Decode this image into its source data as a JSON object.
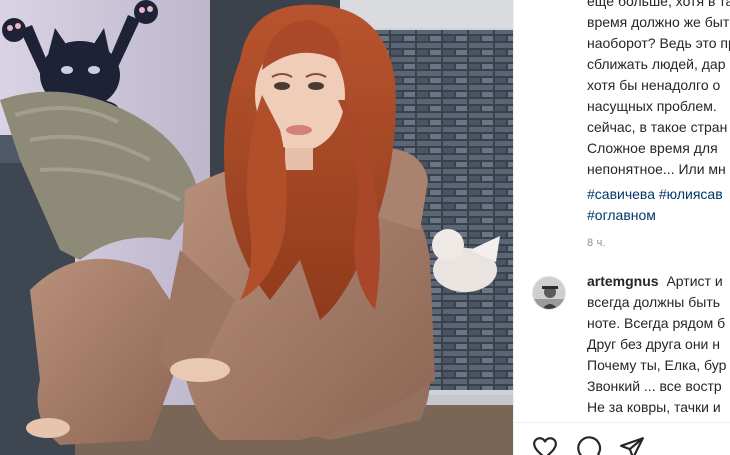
{
  "post": {
    "caption_lines": [
      "ещё больше, хотя в такое",
      "время должно же быть",
      "наоборот? Ведь это пр",
      "сближать людей, дар",
      "хотя бы ненадолго о",
      "насущных проблем.",
      "сейчас, в такое стран",
      "Сложное время для",
      "непонятное... Или мн"
    ],
    "hashtags": [
      "#савичева #юлиясав",
      "#оглавном"
    ],
    "time": "8 ч."
  },
  "comment": {
    "username": "artemgnus",
    "first_line_text": "Артист и",
    "lines": [
      "всегда должны быть",
      "ноте. Всегда рядом б",
      "Друг без друга они н",
      "Почему ты, Елка, бур",
      "Звонкий ... все востр",
      "Не за ковры, тачки и"
    ]
  },
  "actions": {
    "like_icon": "heart-icon",
    "comment_icon": "comment-bubble-icon",
    "share_icon": "paper-plane-icon"
  },
  "colors": {
    "text": "#262626",
    "hashtag": "#00376b",
    "muted": "#8e8e8e",
    "divider": "#efefef"
  }
}
